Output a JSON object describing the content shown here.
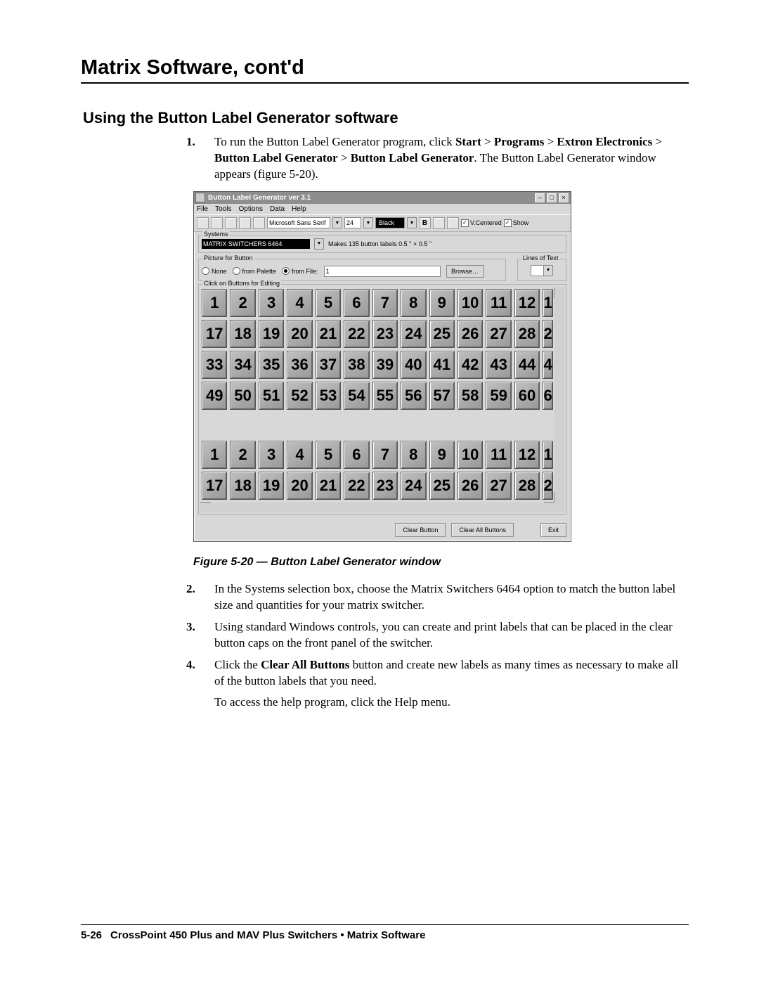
{
  "doc": {
    "chapter_title": "Matrix Software, cont'd",
    "section_title": "Using the Button Label Generator software",
    "step1_num": "1.",
    "step1_a": "To run the Button Label Generator program, click ",
    "step1_b": "Start",
    "step1_gt1": " > ",
    "step1_c": "Programs",
    "step1_gt2": " > ",
    "step1_d": "Extron Electronics",
    "step1_gt3": " > ",
    "step1_e": "Button Label Generator",
    "step1_gt4": " > ",
    "step1_f": "Button Label Generator",
    "step1_g": ". The Button Label Generator window appears (figure 5-20).",
    "caption": "Figure 5-20 — Button Label Generator window",
    "step2_num": "2.",
    "step2_txt": "In the Systems selection box, choose the Matrix Switchers 6464 option to match the button label size and quantities for your matrix switcher.",
    "step3_num": "3.",
    "step3_txt": "Using standard Windows controls, you can create and print labels that can be placed in the clear button caps on the front panel of the switcher.",
    "step4_num": "4.",
    "step4_a": "Click the ",
    "step4_b": "Clear All Buttons",
    "step4_c": " button and create new labels as many times as necessary to make all of the button labels that you need.",
    "help_txt": "To access the help program, click the Help menu.",
    "footer_page": "5-26",
    "footer_txt": "CrossPoint 450 Plus and MAV Plus Switchers • Matrix Software"
  },
  "app": {
    "title": "Button Label Generator   ver 3.1",
    "menu": [
      "File",
      "Tools",
      "Options",
      "Data",
      "Help"
    ],
    "font": "Microsoft Sans Serif",
    "size": "24",
    "color": "Black",
    "bold": "B",
    "vcentered": "V.Centered",
    "show": "Show",
    "systems_legend": "Systems",
    "systems_value": "MATRIX SWITCHERS 6464",
    "systems_note": "Makes 135 button labels 0.5 ''  ×  0.5 ''",
    "picture_legend": "Picture for Button",
    "r_none": "None",
    "r_palette": "from Palette",
    "r_file": "from File:",
    "file_value": "1",
    "browse": "Browse…",
    "lines_legend": "Lines of Text",
    "editing_legend": "Click on Buttons for Editing",
    "rowA": [
      "1",
      "2",
      "3",
      "4",
      "5",
      "6",
      "7",
      "8",
      "9",
      "10",
      "11",
      "12",
      "1"
    ],
    "rowB": [
      "17",
      "18",
      "19",
      "20",
      "21",
      "22",
      "23",
      "24",
      "25",
      "26",
      "27",
      "28",
      "2"
    ],
    "rowC": [
      "33",
      "34",
      "35",
      "36",
      "37",
      "38",
      "39",
      "40",
      "41",
      "42",
      "43",
      "44",
      "4"
    ],
    "rowD": [
      "49",
      "50",
      "51",
      "52",
      "53",
      "54",
      "55",
      "56",
      "57",
      "58",
      "59",
      "60",
      "6"
    ],
    "rowE": [
      "1",
      "2",
      "3",
      "4",
      "5",
      "6",
      "7",
      "8",
      "9",
      "10",
      "11",
      "12",
      "1"
    ],
    "rowF": [
      "17",
      "18",
      "19",
      "20",
      "21",
      "22",
      "23",
      "24",
      "25",
      "26",
      "27",
      "28",
      "2"
    ],
    "btn_clear": "Clear Button",
    "btn_clear_all": "Clear All Buttons",
    "btn_exit": "Exit"
  }
}
